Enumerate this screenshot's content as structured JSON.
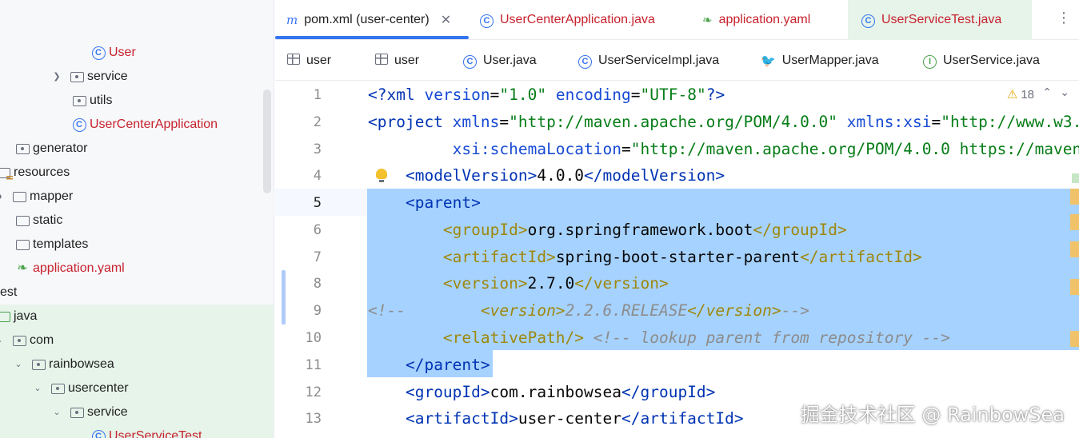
{
  "project_tree": {
    "items": [
      {
        "label": "User",
        "icon": "class-icon",
        "red": true
      },
      {
        "label": "service",
        "icon": "package-icon",
        "chevron": "right"
      },
      {
        "label": "utils",
        "icon": "package-icon"
      },
      {
        "label": "UserCenterApplication",
        "icon": "spring-app-class-icon",
        "red": true
      },
      {
        "label": "generator",
        "icon": "package-icon"
      },
      {
        "label": "resources",
        "icon": "resources-folder-icon"
      },
      {
        "label": "mapper",
        "icon": "folder-icon",
        "chevron": "right"
      },
      {
        "label": "static",
        "icon": "folder-icon"
      },
      {
        "label": "templates",
        "icon": "folder-icon"
      },
      {
        "label": "application.yaml",
        "icon": "spring-leaf-icon",
        "red": true
      },
      {
        "label": "est",
        "icon": "none"
      },
      {
        "label": "java",
        "icon": "test-folder-icon"
      },
      {
        "label": "com",
        "icon": "package-icon",
        "chevron": "down"
      },
      {
        "label": "rainbowsea",
        "icon": "package-icon",
        "chevron": "down"
      },
      {
        "label": "usercenter",
        "icon": "package-icon",
        "chevron": "down"
      },
      {
        "label": "service",
        "icon": "package-icon",
        "chevron": "down"
      },
      {
        "label": "UserServiceTest",
        "icon": "spring-app-class-icon",
        "red": true
      }
    ]
  },
  "editor_tabs": [
    {
      "label": "pom.xml (user-center)",
      "icon": "maven-icon",
      "active": true,
      "closable": true
    },
    {
      "label": "UserCenterApplication.java",
      "icon": "spring-app-class-icon",
      "red": true
    },
    {
      "label": "application.yaml",
      "icon": "spring-leaf-icon",
      "red": true
    },
    {
      "label": "UserServiceTest.java",
      "icon": "spring-app-class-icon",
      "red": true
    }
  ],
  "editor_tabs_row2": [
    {
      "label": "user",
      "icon": "table-icon"
    },
    {
      "label": "user",
      "icon": "table-icon"
    },
    {
      "label": "User.java",
      "icon": "class-icon"
    },
    {
      "label": "UserServiceImpl.java",
      "icon": "class-icon"
    },
    {
      "label": "UserMapper.java",
      "icon": "mybatis-bird-icon"
    },
    {
      "label": "UserService.java",
      "icon": "interface-icon"
    }
  ],
  "inspections": {
    "warning_count": "18"
  },
  "code": {
    "line_numbers": [
      "1",
      "2",
      "3",
      "4",
      "5",
      "6",
      "7",
      "8",
      "9",
      "10",
      "11",
      "12",
      "13"
    ],
    "current_line": "5"
  },
  "watermark": "掘金技术社区 @ RainbowSea",
  "colors": {
    "accent": "#3574f0",
    "selection": "#a6d2ff",
    "red_label": "#c7222d",
    "test_bg": "#e6f4ea"
  }
}
